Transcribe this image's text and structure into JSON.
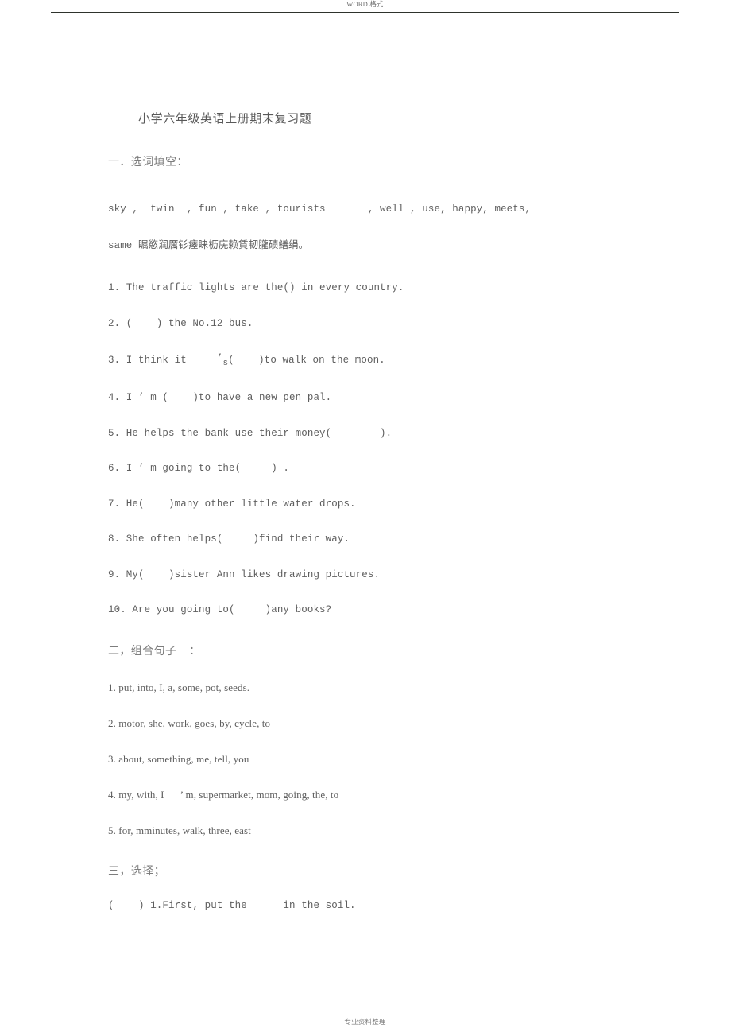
{
  "header": {
    "watermark": "WORD 格式"
  },
  "footer": {
    "watermark": "专业资料整理"
  },
  "document": {
    "title": "小学六年级英语上册期末复习题",
    "sections": [
      {
        "heading": "一．选词填空：",
        "word_bank_line1": "sky ,  twin  , fun , take , tourists       , well , use, happy, meets,",
        "word_bank_line2_prefix": "same ",
        "word_bank_line2_cjk": "瞩慾润厲钐瘗睐枥庑赖賃韧朧碛鳝绢。",
        "questions": [
          "1. The traffic lights are the() in every country.",
          "2. (    ) the No.12 bus.",
          "4. I ’ m (    )to have a new pen pal.",
          "5. He helps the bank use their money(        ).",
          "6. I ’ m going to the(     ) .",
          "7. He(    )many other little water drops.",
          "8. She often helps(     )find their way.",
          "9. My(    )sister Ann likes drawing pictures.",
          "10. Are you going to(     )any books?"
        ],
        "question3": {
          "prefix": "3. I think it     ",
          "apostrophe": "’",
          "subscript_s": "s",
          "suffix": "(    )to walk on the moon."
        }
      },
      {
        "heading": "二，组合句子    ：",
        "items": [
          "1. put, into, I, a, some, pot, seeds.",
          "2. motor, she, work, goes, by, cycle, to",
          "3. about, something, me, tell, you",
          "5. for, mminutes, walk, three, east"
        ],
        "item4": "4. my, with, I      ’ m, supermarket, mom, going, the, to"
      },
      {
        "heading": "三，选择；",
        "items": [
          "(    ) 1.First, put the      in the soil."
        ]
      }
    ]
  },
  "colors": {
    "text": "#5e5e5e",
    "heading": "#7d7d7d",
    "rule": "#2e332c",
    "page_background": "#ffffff"
  }
}
